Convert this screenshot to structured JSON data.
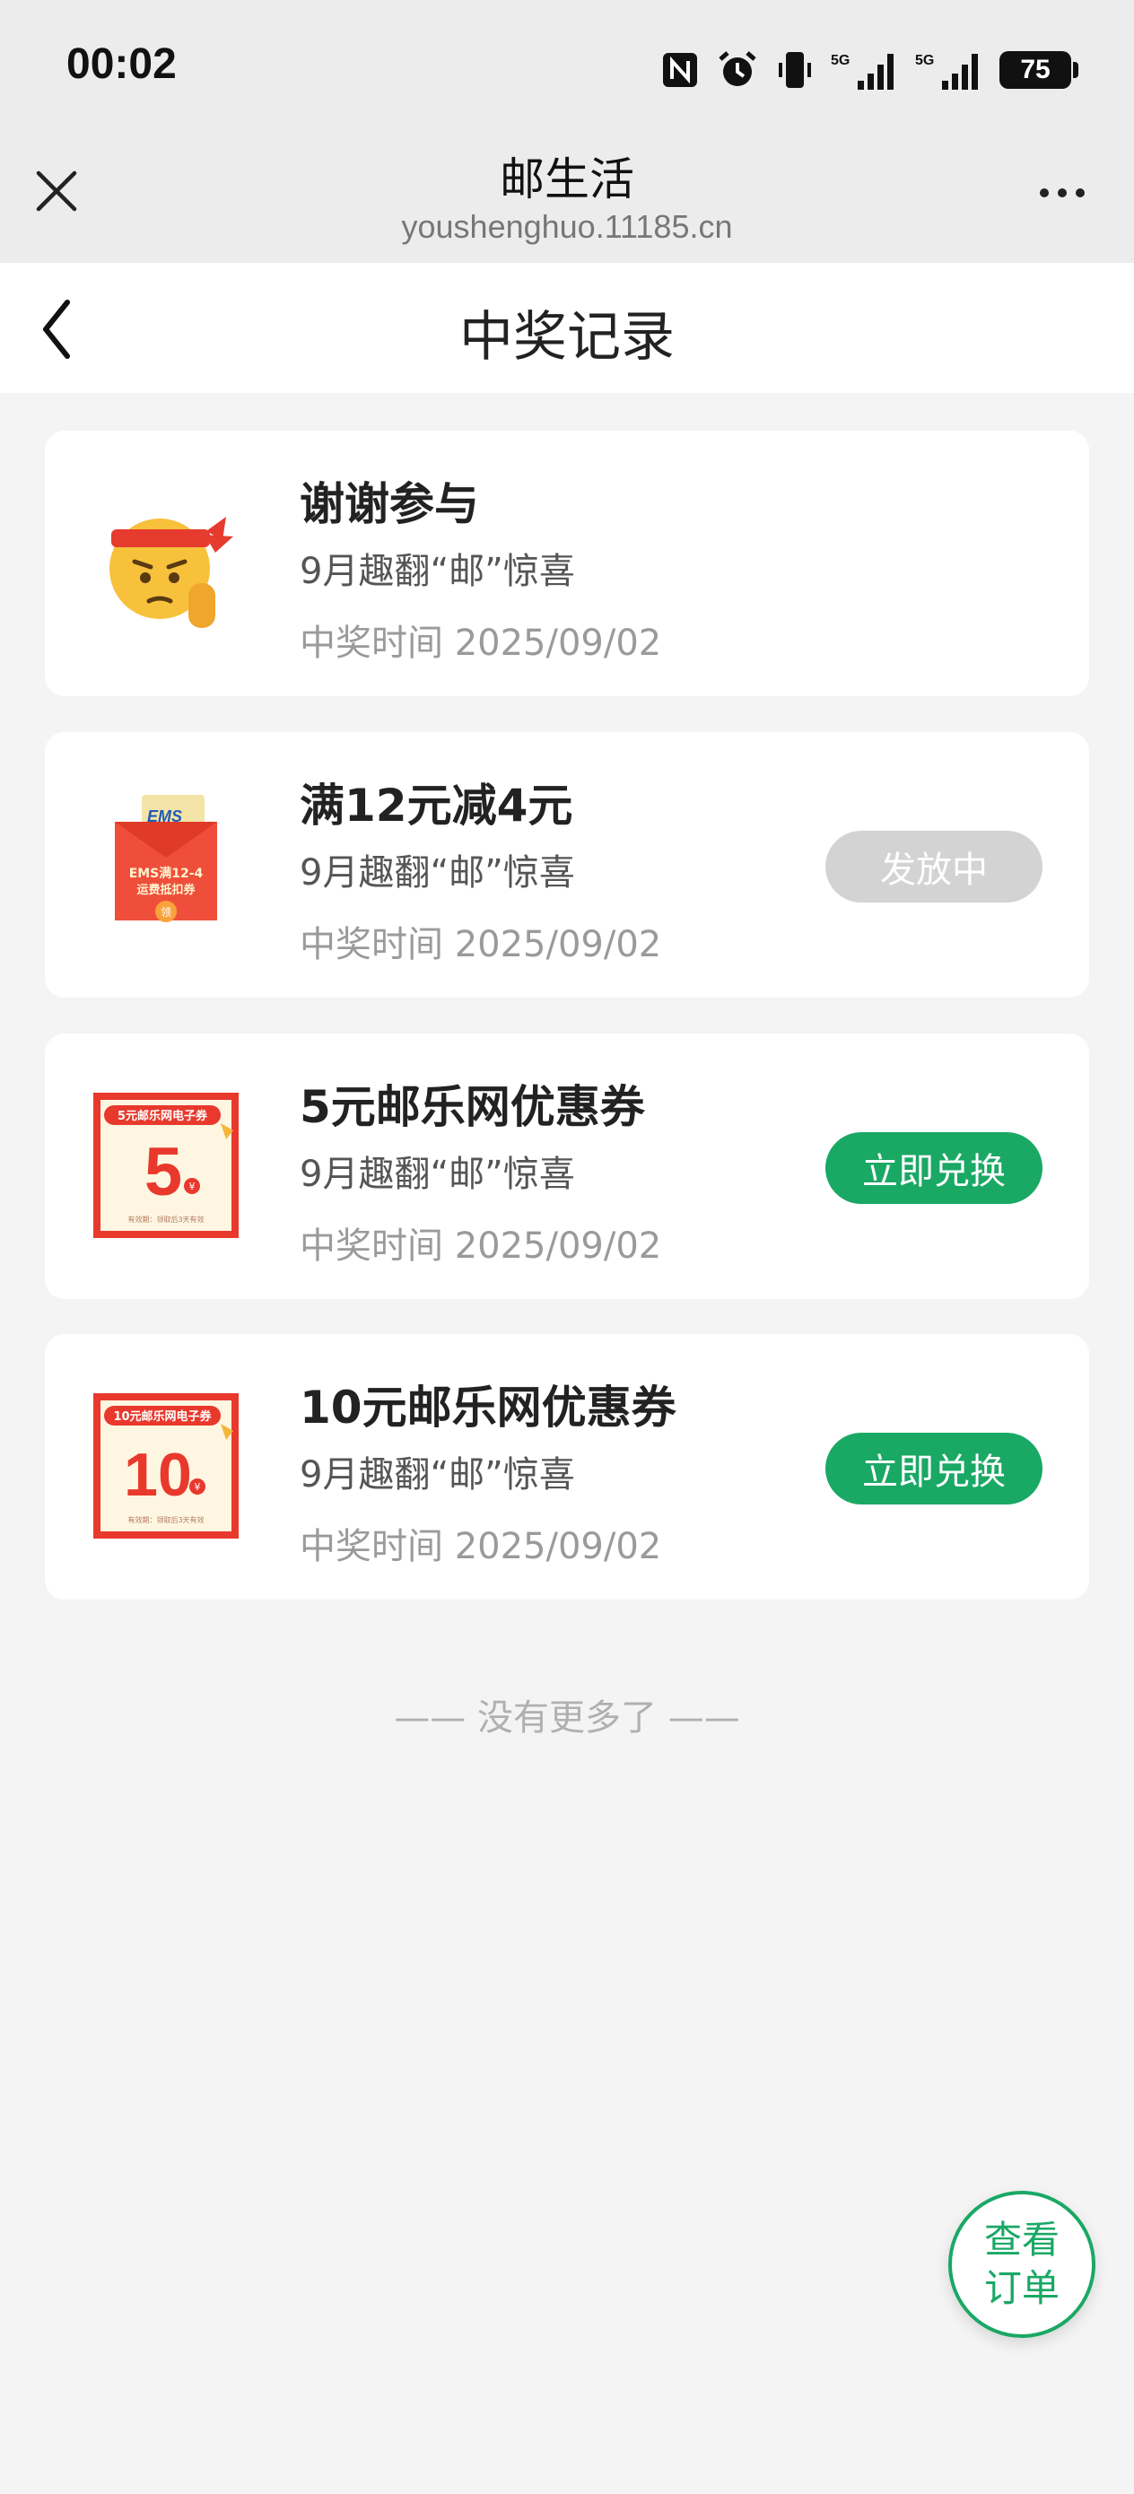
{
  "status_bar": {
    "time": "00:02",
    "battery": "75"
  },
  "web_header": {
    "title": "邮生活",
    "url": "youshenghuo.11185.cn"
  },
  "page": {
    "title": "中奖记录"
  },
  "records": [
    {
      "title": "谢谢参与",
      "subtitle": "9月趣翻“邮”惊喜",
      "time": "中奖时间 2025/09/02",
      "icon": "thank-you-emoji-icon",
      "button": null
    },
    {
      "title": "满12元减4元",
      "subtitle": "9月趣翻“邮”惊喜",
      "time": "中奖时间 2025/09/02",
      "icon": "ems-red-envelope-icon",
      "button": "发放中",
      "envelope": {
        "brand": "EMS",
        "line1": "EMS满12-4",
        "line2": "运费抵扣券",
        "seal": "领"
      }
    },
    {
      "title": "5元邮乐网优惠券",
      "subtitle": "9月趣翻“邮”惊喜",
      "time": "中奖时间 2025/09/02",
      "icon": "coupon-5-icon",
      "button": "立即兑换",
      "coupon": {
        "header": "5元邮乐网电子券",
        "amount": "5",
        "unit": "¥",
        "footer": "有效期：领取后3天有效"
      }
    },
    {
      "title": "10元邮乐网优惠券",
      "subtitle": "9月趣翻“邮”惊喜",
      "time": "中奖时间 2025/09/02",
      "icon": "coupon-10-icon",
      "button": "立即兑换",
      "coupon": {
        "header": "10元邮乐网电子券",
        "amount": "10",
        "unit": "¥",
        "footer": "有效期：领取后3天有效"
      }
    }
  ],
  "footer_text": "—— 没有更多了 ——",
  "fab": {
    "label": "查看订单"
  },
  "colors": {
    "accent": "#1aa865",
    "disabled": "#d3d3d3",
    "background": "#f4f4f4"
  }
}
